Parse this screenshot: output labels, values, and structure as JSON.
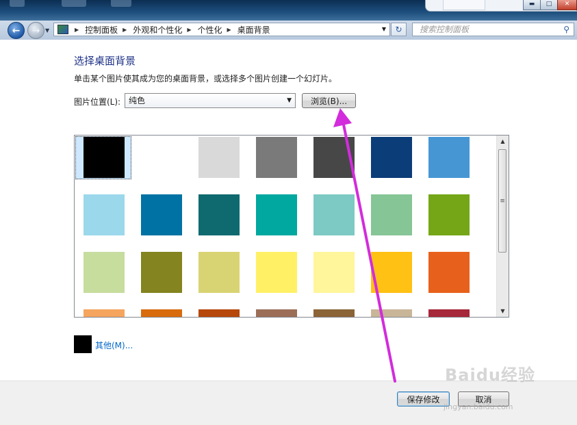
{
  "window": {
    "minimize_label": "▬",
    "maximize_label": "□",
    "close_label": "✕"
  },
  "nav": {
    "breadcrumbs": [
      "控制面板",
      "外观和个性化",
      "个性化",
      "桌面背景"
    ],
    "search_placeholder": "搜索控制面板"
  },
  "main": {
    "title": "选择桌面背景",
    "subtitle": "单击某个图片使其成为您的桌面背景，或选择多个图片创建一个幻灯片。",
    "location_label": "图片位置(L):",
    "location_value": "纯色",
    "browse_label": "浏览(B)...",
    "other_label": "其他(M)..."
  },
  "colors": [
    [
      "#000000",
      "#ffffff",
      "#d9d9d9",
      "#7a7a7a",
      "#474747",
      "#0b3d78",
      "#4796d4"
    ],
    [
      "#9bd8ec",
      "#0072a3",
      "#0f6a6f",
      "#00a89f",
      "#7dcac4",
      "#86c596",
      "#74a617"
    ],
    [
      "#c6dd9e",
      "#848420",
      "#d9d473",
      "#fff066",
      "#fff59b",
      "#ffc114",
      "#e8611c"
    ],
    [
      "#f5a55e",
      "#d86b0e",
      "#b6480c",
      "#9c6e58",
      "#8b6437",
      "#c9b598",
      "#a6283a"
    ]
  ],
  "footer": {
    "save_label": "保存修改",
    "cancel_label": "取消"
  },
  "watermark": {
    "text": "Baidu经验",
    "url": "jingyan.baidu.com"
  }
}
